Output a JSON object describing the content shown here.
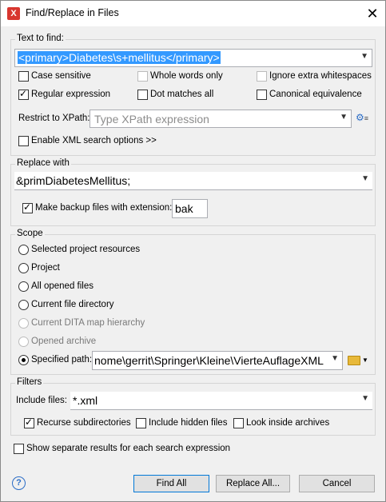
{
  "window": {
    "title": "Find/Replace in Files",
    "close": "✕"
  },
  "text_to_find": {
    "legend": "Text to find:",
    "value": "<primary>Diabetes\\s+mellitus</primary>",
    "options": {
      "case_sensitive": {
        "label": "Case sensitive",
        "checked": false
      },
      "whole_words": {
        "label": "Whole words only",
        "checked": false,
        "disabled": true
      },
      "ignore_whitespace": {
        "label": "Ignore extra whitespaces",
        "checked": false,
        "disabled": true
      },
      "regex": {
        "label": "Regular expression",
        "checked": true
      },
      "dot_matches_all": {
        "label": "Dot matches all",
        "checked": false
      },
      "canonical": {
        "label": "Canonical equivalence",
        "checked": false
      }
    },
    "restrict_label": "Restrict to XPath:",
    "xpath_placeholder": "Type XPath expression",
    "xml_options_label": "Enable XML search options >>"
  },
  "replace_with": {
    "legend": "Replace with",
    "value": "&primDiabetesMellitus;",
    "backup_label": "Make backup files with extension:",
    "backup_checked": true,
    "backup_ext": "bak"
  },
  "scope": {
    "legend": "Scope",
    "options": [
      {
        "label": "Selected project resources",
        "disabled": false
      },
      {
        "label": "Project",
        "disabled": false
      },
      {
        "label": "All opened files",
        "disabled": false
      },
      {
        "label": "Current file directory",
        "disabled": false
      },
      {
        "label": "Current DITA map hierarchy",
        "disabled": true
      },
      {
        "label": "Opened archive",
        "disabled": true
      },
      {
        "label": "Specified path:",
        "disabled": false
      }
    ],
    "selected": "Specified path:",
    "path_value": "nome\\gerrit\\Springer\\Kleine\\VierteAuflageXML"
  },
  "filters": {
    "legend": "Filters",
    "include_label": "Include files:",
    "include_value": "*.xml",
    "recurse": {
      "label": "Recurse subdirectories",
      "checked": true
    },
    "hidden": {
      "label": "Include hidden files",
      "checked": false
    },
    "archives": {
      "label": "Look inside archives",
      "checked": false
    }
  },
  "separate_results_label": "Show separate results for each search expression",
  "buttons": {
    "find_all": "Find All",
    "replace_all": "Replace All...",
    "cancel": "Cancel",
    "help": "?"
  }
}
